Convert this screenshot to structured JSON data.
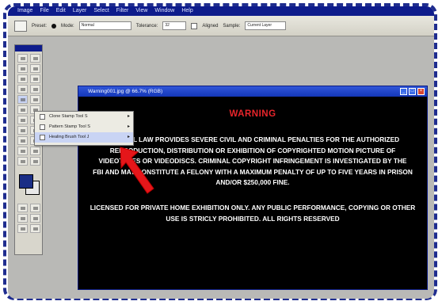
{
  "menubar": {
    "items": [
      "Image",
      "File",
      "Edit",
      "Layer",
      "Select",
      "Filter",
      "View",
      "Window",
      "Help"
    ]
  },
  "options_bar": {
    "preset_label": "Preset:",
    "blend_label": "Mode:",
    "blend_value": "Normal",
    "tolerance_label": "Tolerance:",
    "tolerance_value": "32",
    "aligned_label": "Aligned",
    "sample_label": "Sample:",
    "sample_value": "Current Layer"
  },
  "document": {
    "title": "Warning001.jpg @ 66.7% (RGB)",
    "warning_title": "WARNING",
    "body": "FEDERAL LAW PROVIDES SEVERE CIVIL AND CRIMINAL PENALTIES FOR THE AUTHORIZED REPRODUCTION, DISTRIBUTION OR EXHIBITION OF COPYRIGHTED MOTION PICTURE OF VIDEOTAPES OR VIDEODISCS. CRIMINAL COPYRIGHT INFRINGEMENT IS INVESTIGATED BY THE FBI AND MAY CONSTITUTE A FELONY WITH A MAXIMUM PENALTY OF UP TO FIVE YEARS IN PRISON AND/OR $250,000 FINE.",
    "licensed": "LICENSED FOR PRIVATE HOME EXHIBITION ONLY. ANY PUBLIC PERFORMANCE, COPYING OR OTHER USE IS STRICLY PROHIBITED. ALL RIGHTS RESERVED"
  },
  "flyout": {
    "items": [
      {
        "label": "Clone Stamp Tool   S"
      },
      {
        "label": "Pattern Stamp Tool   S"
      },
      {
        "label": "Healing Brush Tool   J"
      }
    ]
  },
  "colors": {
    "accent": "#1f2d8f",
    "warning_red": "#e8252b",
    "arrow_red": "#e5161a"
  }
}
